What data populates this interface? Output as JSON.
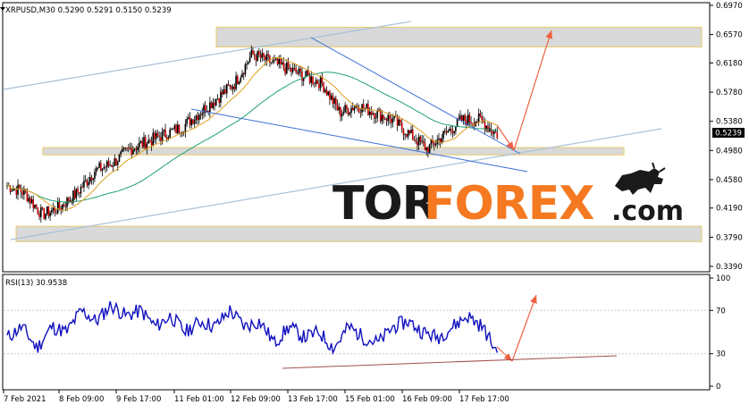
{
  "header": {
    "symbol_line": "XRPUSD,M30  0.5290 0.5291 0.5150 0.5239",
    "rsi_line": "RSI(13) 30.9538"
  },
  "logo": {
    "tor": "TOR",
    "forex": "FOREX",
    "dotcom": ".com"
  },
  "price_badge": "0.5239",
  "colors": {
    "candle": "#000000",
    "bear_body": "#cc0000",
    "ma_fast": "#e0a020",
    "ma_slow": "#20a070",
    "channel": "#aac2d8",
    "trend_blue": "#3a6fd8",
    "zone_fill": "#d9d9d9",
    "zone_border": "#e8c96a",
    "arrow": "#f06040",
    "rsi_line": "#1010c0",
    "rsi_trend": "#a05050",
    "logo_dark": "#1a1a1a",
    "logo_orange": "#f47920"
  },
  "chart_data": [
    {
      "type": "line",
      "subtype": "candlestick",
      "title": "XRPUSD,M30",
      "ohlc_last": {
        "open": 0.529,
        "high": 0.5291,
        "low": 0.515,
        "close": 0.5239
      },
      "y_ticks": [
        0.697,
        0.657,
        0.618,
        0.578,
        0.538,
        0.498,
        0.458,
        0.419,
        0.379,
        0.339
      ],
      "y_tick_labels": [
        "0.6970",
        "0.6570",
        "0.6180",
        "0.5780",
        "0.5380",
        "0.4980",
        "0.4580",
        "0.4190",
        "0.3790",
        "0.3390"
      ],
      "ylim": [
        0.339,
        0.697
      ],
      "x_tick_labels": [
        "7 Feb 2021",
        "8 Feb 09:00",
        "9 Feb 17:00",
        "11 Feb 01:00",
        "12 Feb 09:00",
        "13 Feb 17:00",
        "15 Feb 01:00",
        "16 Feb 09:00",
        "17 Feb 17:00"
      ],
      "close_path_approx": [
        0.45,
        0.44,
        0.41,
        0.42,
        0.44,
        0.47,
        0.48,
        0.5,
        0.51,
        0.52,
        0.53,
        0.55,
        0.57,
        0.59,
        0.63,
        0.62,
        0.61,
        0.6,
        0.59,
        0.55,
        0.56,
        0.55,
        0.54,
        0.52,
        0.5,
        0.52,
        0.54,
        0.54,
        0.52
      ],
      "zones": [
        [
          0.64,
          0.667
        ],
        [
          0.492,
          0.502
        ],
        [
          0.373,
          0.394
        ]
      ],
      "grid": false,
      "legend": "none"
    },
    {
      "type": "line",
      "title": "RSI(13) 30.9538",
      "current_value": 30.9538,
      "y_ticks": [
        100,
        70,
        30,
        0
      ],
      "y_tick_labels": [
        "100",
        "70",
        "30",
        "0"
      ],
      "ylim": [
        0,
        100
      ],
      "values_approx": [
        45,
        55,
        35,
        55,
        50,
        70,
        60,
        75,
        65,
        70,
        55,
        65,
        50,
        60,
        55,
        70,
        55,
        60,
        40,
        55,
        45,
        50,
        35,
        55,
        45,
        40,
        55,
        60,
        50,
        45,
        55,
        65,
        55,
        31
      ],
      "grid": false,
      "legend": "none"
    }
  ]
}
